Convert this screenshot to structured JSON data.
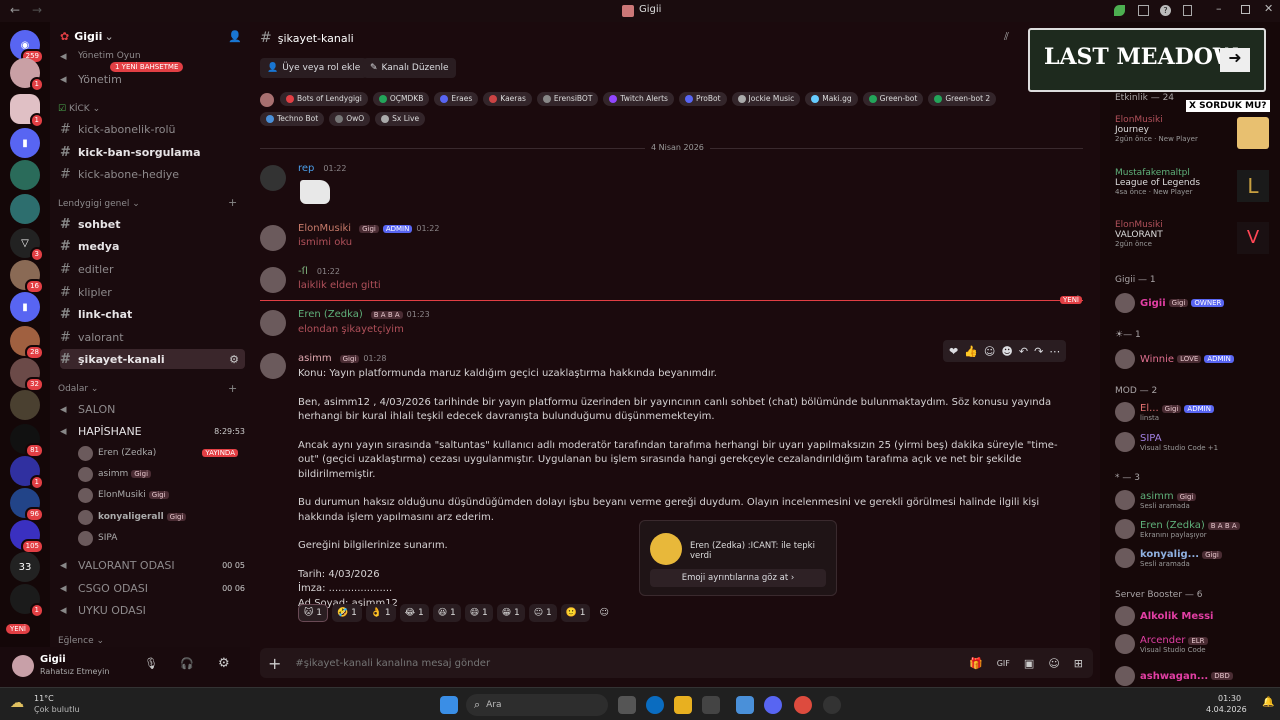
{
  "window": {
    "title": "Gigii"
  },
  "rail": {
    "badges": [
      "259",
      "1",
      "1",
      "3",
      "16",
      "28",
      "32",
      "81",
      "1",
      "96",
      "105",
      "33",
      "1"
    ],
    "new_label": "YENİ"
  },
  "server": {
    "name": "Gigii",
    "new_mention": "1 YENİ BAHSETME"
  },
  "channels": {
    "top": [
      "Yönetim Oyun",
      "Yönetim"
    ],
    "cat_kick": "KİCK",
    "kick": [
      "kick-abonelik-rolü",
      "kick-ban-sorgulama",
      "kick-abone-hediye"
    ],
    "cat_general": "Lendygigi genel",
    "general": [
      "sohbet",
      "medya",
      "editler",
      "klipler",
      "link-chat",
      "valorant",
      "şikayet-kanali"
    ],
    "cat_rooms": "Odalar",
    "rooms": [
      "SALON",
      "HAPİSHANE"
    ],
    "hapishane_timer": "8:29:53",
    "voice_users": [
      "Eren (Zedka)",
      "asimm",
      "ElonMusiki",
      "konyaligerall",
      "SIPA"
    ],
    "voice_tags": [
      "YAYINDA",
      "Gigi",
      "Gigi",
      "Gigi"
    ],
    "rooms2": [
      "VALORANT ODASI",
      "CSGO ODASI",
      "UYKU ODASI"
    ],
    "room_counts": [
      [
        "00",
        "05"
      ],
      [
        "00",
        "06"
      ]
    ],
    "cat_more": "Eğlence"
  },
  "user": {
    "name": "Gigii",
    "status": "Rahatsız Etmeyin"
  },
  "chat": {
    "channel": "şikayet-kanali",
    "btn_role": "Üye veya rol ekle",
    "btn_edit": "Kanalı Düzenle",
    "bots": [
      "Bots of Lendygigi",
      "OÇMDKB",
      "Eraes",
      "Kaeras",
      "ErensiBOT",
      "Twitch Alerts",
      "ProBot",
      "Jockie Music",
      "Maki.gg",
      "Green-bot",
      "Green-bot 2",
      "Techno Bot",
      "OwO",
      "Sx Live"
    ],
    "date": "4 Nisan 2026",
    "new_label": "YENİ",
    "messages": [
      {
        "author": "rep",
        "time": "01:22",
        "text": ""
      },
      {
        "author": "ElonMusiki",
        "tag": "Gigi",
        "role": "ADMIN",
        "time": "01:22",
        "text": "ismimi oku"
      },
      {
        "author": "-ſl",
        "time": "01:22",
        "text": "laiklik elden gitti"
      },
      {
        "author": "Eren (Zedka)",
        "tag": "B A B A",
        "time": "01:23",
        "text": "elondan şikayetçiyim"
      },
      {
        "author": "asimm",
        "tag": "Gigi",
        "time": "01:28"
      }
    ],
    "long": [
      "Konu: Yayın platformunda maruz kaldığım geçici uzaklaştırma hakkında beyanımdır.",
      "Ben, asimm12 , 4/03/2026 tarihinde bir yayın platformu üzerinden bir yayıncının canlı sohbet (chat) bölümünde bulunmaktaydım. Söz konusu yayında herhangi bir kural ihlali teşkil edecek davranışta bulunduğumu düşünmemekteyim.",
      "Ancak aynı yayın sırasında \"saltuntas\" kullanıcı adlı moderatör tarafından tarafıma herhangi bir uyarı yapılmaksızın 25 (yirmi beş) dakika süreyle \"time-out\" (geçici uzaklaştırma) cezası uygulanmıştır. Uygulanan bu işlem sırasında hangi gerekçeyle cezalandırıldığım tarafıma açık ve net bir şekilde bildirilmemiştir.",
      "Bu durumun haksız olduğunu düşündüğümden dolayı işbu beyanı verme gereği duydum. Olayın incelenmesini ve gerekli görülmesi halinde ilgili kişi hakkında işlem yapılmasını arz ederim.",
      "Gereğini bilgilerinize sunarım.",
      "Tarih: 4/03/2026",
      "İmza: ....................",
      "Ad Soyad: asimm12"
    ],
    "reactions": [
      "1",
      "1",
      "1",
      "1",
      "1",
      "1",
      "1",
      "1",
      "1"
    ],
    "tooltip": {
      "text": "Eren (Zedka) :ICANT: ile tepki verdi",
      "button": "Emoji ayrıntılarına göz at ›"
    },
    "input_placeholder": "#şikayet-kanali kanalına mesaj gönder"
  },
  "members": {
    "banner": "LAST MEADOW",
    "banner_tag": "X SORDUK MU?",
    "activity_header": "Etkinlik — 24",
    "activities": [
      {
        "name": "ElonMusiki",
        "game": "Journey",
        "meta": "2gün önce · New Player"
      },
      {
        "name": "Mustafakemaltpl",
        "game": "League of Legends",
        "meta": "4sa önce · New Player"
      },
      {
        "name": "ElonMusiki",
        "game": "VALORANT",
        "meta": "2gün önce"
      }
    ],
    "groups": [
      {
        "h": "Gigii — 1",
        "m": [
          {
            "n": "Gigii",
            "t": "Gigi",
            "r": "OWNER"
          }
        ]
      },
      {
        "h": "— 1",
        "m": [
          {
            "n": "Winnie",
            "t": "LOVE",
            "r": "ADMIN"
          }
        ]
      },
      {
        "h": "MOD — 2",
        "m": [
          {
            "n": "El...",
            "t": "Gigi",
            "r": "ADMIN",
            "s": "linsta"
          },
          {
            "n": "SIPA",
            "s": "Visual Studio Code +1"
          }
        ]
      },
      {
        "h": "* — 3",
        "m": [
          {
            "n": "asimm",
            "t": "Gigi",
            "s": "Sesli aramada"
          },
          {
            "n": "Eren (Zedka)",
            "t": "B A B A",
            "s": "Ekranını paylaşıyor"
          },
          {
            "n": "konyalig...",
            "t": "Gigi",
            "s": "Sesli aramada"
          }
        ]
      },
      {
        "h": "Server Booster — 6",
        "m": [
          {
            "n": "Alkolik Messi"
          },
          {
            "n": "Arcender",
            "t": "ELR",
            "s": "Visual Studio Code"
          },
          {
            "n": "ashwagan...",
            "t": "DBD"
          }
        ]
      }
    ]
  },
  "taskbar": {
    "weather_temp": "11°C",
    "weather_desc": "Çok bulutlu",
    "search": "Ara",
    "time": "01:30",
    "date": "4.04.2026"
  },
  "colors": {
    "accent": "#e23f44",
    "admin": "#5865f2",
    "online": "#23a55a"
  }
}
